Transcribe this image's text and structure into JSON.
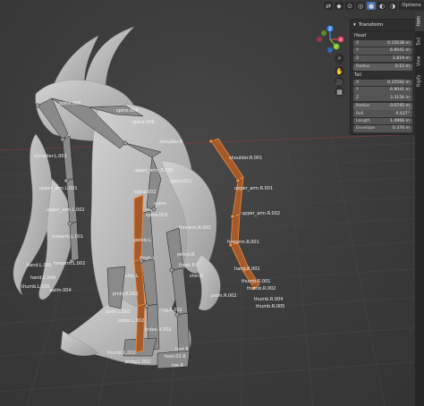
{
  "header": {
    "options_label": "Options",
    "buttons": [
      "⇄",
      "◆",
      "⊙",
      "◎",
      "●",
      "◐",
      "◑",
      "▾"
    ]
  },
  "gizmo": {
    "axes": {
      "x": "X",
      "y": "Y",
      "z": "Z"
    },
    "axis_colors": {
      "x": "#e3405b",
      "y": "#7ec22b",
      "z": "#3a8cf5",
      "neg_x": "#9c3447",
      "neg_y": "#5c8e2b",
      "neg_z": "#2f67b4"
    },
    "tools": [
      "zoom-icon",
      "hand-icon",
      "camera-icon",
      "grid-icon"
    ],
    "tool_glyphs": [
      "⌕",
      "✋",
      "🎥",
      "▦"
    ]
  },
  "sidebar": {
    "panel_title": "Transform",
    "head_label": "Head",
    "tail_label": "Tail",
    "head": [
      {
        "label": "X",
        "value": "0.15638 m"
      },
      {
        "label": "Y",
        "value": "6.9041 m"
      },
      {
        "label": "Z",
        "value": "1.819 m"
      }
    ],
    "head_radius": {
      "label": "Radius",
      "value": "0.15 m"
    },
    "tail": [
      {
        "label": "X",
        "value": "0.15592 m"
      },
      {
        "label": "Y",
        "value": "6.9041 m"
      },
      {
        "label": "Z",
        "value": "3.3156 m"
      }
    ],
    "tail_radius": {
      "label": "Radius",
      "value": "0.0745 m"
    },
    "roll": {
      "label": "Roll",
      "value": "0.037°"
    },
    "length": {
      "label": "Length",
      "value": "1.4966 m"
    },
    "envelope": {
      "label": "Envelope",
      "value": "0.374 m"
    },
    "tabs": [
      "Item",
      "Tool",
      "View",
      "Rigify"
    ]
  },
  "bone_labels": [
    "spine.005",
    "spine.004",
    "spine.006",
    "shoulder.R",
    "shoulder.L.001",
    "upper_arm.L.001",
    "upper_arm.L.002",
    "forearm.L.001",
    "forearm.L.002",
    "hand.L.001",
    "hand.L.004",
    "thumb.L.005",
    "palm.004",
    "shoulder.R.001",
    "upper_arm_R.001",
    "upper_arm.R.001",
    "upper_arm.R.002",
    "forearm.R.001",
    "forearm.R.002",
    "hand.R.001",
    "thumb.R.001",
    "thumb.R.002",
    "palm.R.002",
    "thumb.R.004",
    "thumb.R.005",
    "pelvis.L",
    "pelvis.R",
    "thigh.L",
    "thigh.R",
    "spine.003",
    "spine.002",
    "spine.001",
    "spine",
    "shin.L",
    "shin.R",
    "foot.R",
    "heel.02.R",
    "toe.R",
    "index.R.002",
    "pinky.R.002",
    "index.L.002",
    "ring.R.002",
    "thumb.L.002",
    "pinky.L.002",
    "palm.L.002"
  ],
  "colors": {
    "accent": "#4772b3",
    "bone_fill": "#8a8a8a",
    "bone_selected": "#f08a3c",
    "mesh": "#bdbdbd",
    "grid": "#4a4a4a"
  }
}
